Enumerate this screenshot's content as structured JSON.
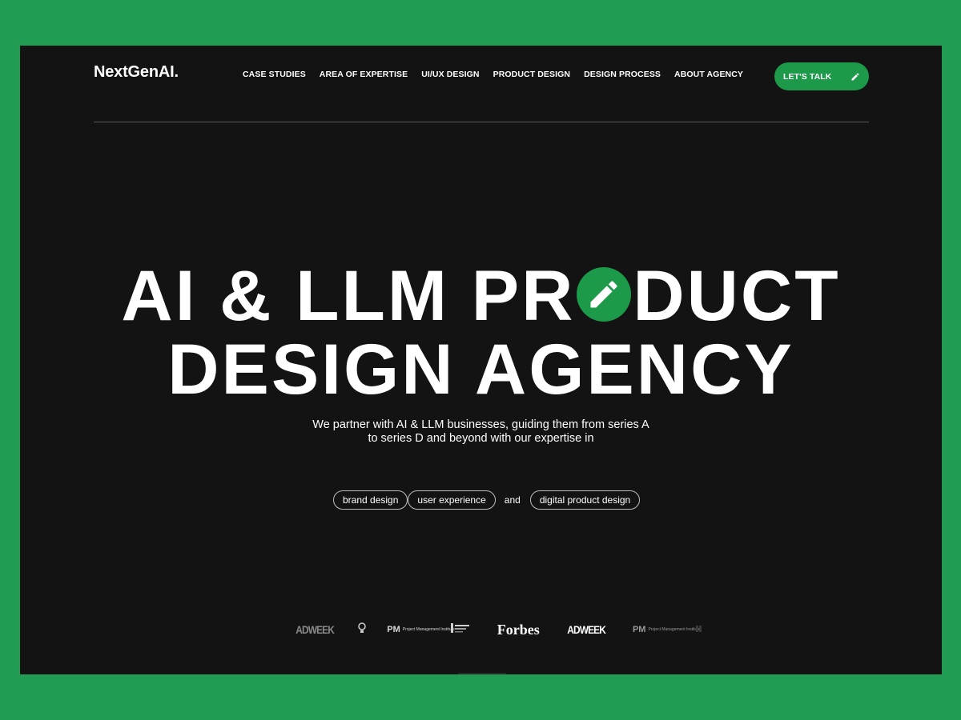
{
  "brand": {
    "logo": "NextGenAI."
  },
  "nav": {
    "items": [
      {
        "label": "CASE STUDIES"
      },
      {
        "label": "AREA OF EXPERTISE"
      },
      {
        "label": "UI/UX DESIGN"
      },
      {
        "label": "PRODUCT DESIGN"
      },
      {
        "label": "DESIGN PROCESS"
      },
      {
        "label": "ABOUT AGENCY"
      }
    ],
    "cta": {
      "label": "LET'S TALK",
      "icon": "pencil-icon"
    }
  },
  "hero": {
    "line1_before": "AI & LLM PR",
    "line1_after": "DUCT",
    "line1_badge_icon": "pencil-icon",
    "line2": "DESIGN AGENCY"
  },
  "intro": {
    "line1": "We partner with AI & LLM businesses, guiding them from series A",
    "line2": "to series D and beyond with our expertise in"
  },
  "expertise": {
    "pills": [
      "brand design",
      "user experience",
      "digital product design"
    ],
    "connector": "and"
  },
  "press_logos": {
    "adweek_1": "ADWEEK",
    "pmi_1_mark": "PM",
    "pmi_1_text": "Project Management Institute",
    "forbes": "Forbes",
    "adweek_2": "ADWEEK",
    "pmi_2_mark": "PM",
    "pmi_2_text": "Project Management Institute"
  },
  "colors": {
    "accent": "#1c9a49",
    "frame": "#219c53",
    "background": "#131313",
    "text": "#ffffff"
  }
}
